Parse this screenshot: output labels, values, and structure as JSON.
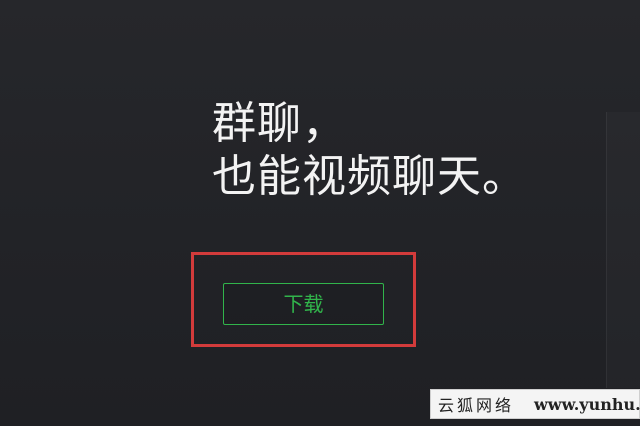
{
  "colors": {
    "background": "#242529",
    "headline_text": "#f3f3f3",
    "button_accent": "#31b44b",
    "highlight_box": "#d23b3b",
    "watermark_bg": "#f4f4f4"
  },
  "headline": {
    "line1": "群聊，",
    "line2": "也能视频聊天。"
  },
  "download": {
    "label": "下载"
  },
  "watermark": {
    "cn": "云狐网络",
    "en": "www.yunhu.net"
  }
}
